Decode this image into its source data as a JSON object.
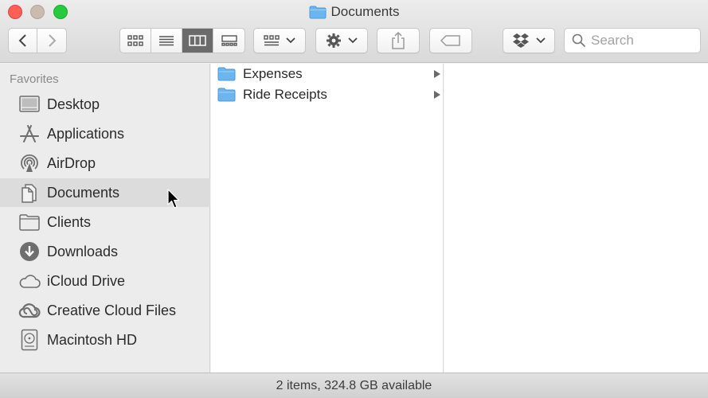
{
  "window": {
    "title": "Documents"
  },
  "toolbar": {
    "search_placeholder": "Search",
    "view_modes": [
      "icon-view",
      "list-view",
      "column-view",
      "gallery-view"
    ],
    "active_view": "column-view"
  },
  "sidebar": {
    "heading": "Favorites",
    "items": [
      {
        "label": "Desktop",
        "icon": "desktop-icon"
      },
      {
        "label": "Applications",
        "icon": "applications-icon"
      },
      {
        "label": "AirDrop",
        "icon": "airdrop-icon"
      },
      {
        "label": "Documents",
        "icon": "documents-icon",
        "selected": true
      },
      {
        "label": "Clients",
        "icon": "folder-icon"
      },
      {
        "label": "Downloads",
        "icon": "downloads-icon"
      },
      {
        "label": "iCloud Drive",
        "icon": "cloud-icon"
      },
      {
        "label": "Creative Cloud Files",
        "icon": "creative-cloud-icon"
      },
      {
        "label": "Macintosh HD",
        "icon": "hard-drive-icon"
      }
    ]
  },
  "columns": [
    {
      "items": [
        {
          "label": "Expenses"
        },
        {
          "label": "Ride Receipts"
        }
      ]
    }
  ],
  "status": {
    "text": "2 items, 324.8 GB available"
  },
  "colors": {
    "folder": "#6bb6f0",
    "selection": "#dcdcdc",
    "close": "#ff5f57",
    "zoom": "#27c93f"
  }
}
